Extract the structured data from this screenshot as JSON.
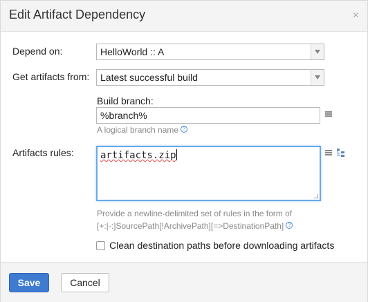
{
  "dialog": {
    "title": "Edit Artifact Dependency",
    "close_glyph": "×"
  },
  "depend_on": {
    "label": "Depend on:",
    "value": "HelloWorld :: A"
  },
  "get_artifacts": {
    "label": "Get artifacts from:",
    "value": "Latest successful build"
  },
  "build_branch": {
    "label": "Build branch:",
    "value": "%branch%",
    "hint": "A logical branch name",
    "help_glyph": "?"
  },
  "artifacts_rules": {
    "label": "Artifacts rules:",
    "value": "artifacts.zip",
    "description_line1": "Provide a newline-delimited set of rules in the form of",
    "description_line2": "[+:|-:]SourcePath[!ArchivePath][=>DestinationPath]",
    "help_glyph": "?"
  },
  "clean_destination": {
    "label": "Clean destination paths before downloading artifacts",
    "checked": false
  },
  "buttons": {
    "save": "Save",
    "cancel": "Cancel"
  },
  "colors": {
    "primary": "#3f7bd0",
    "focus_border": "#68a9e8",
    "hint_text": "#888888"
  }
}
